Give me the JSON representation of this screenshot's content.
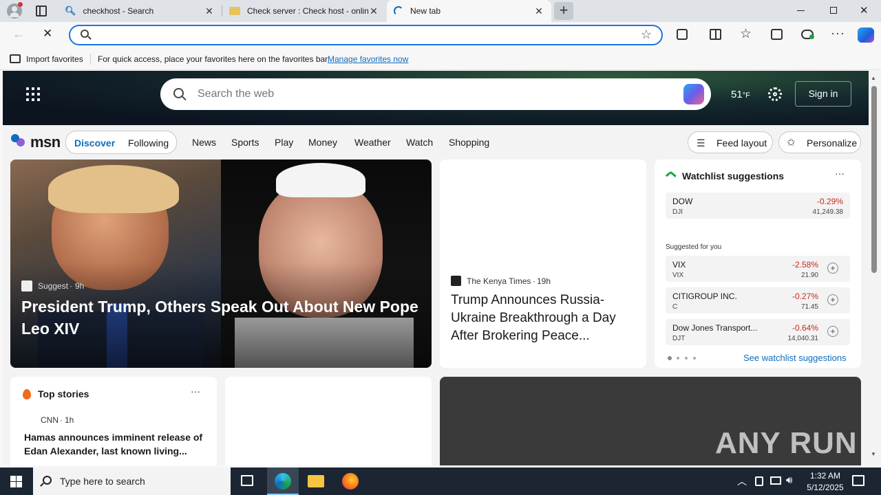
{
  "tabs": [
    {
      "title": "checkhost - Search",
      "icon": "search-icon"
    },
    {
      "title": "Check server : Check host - onlin",
      "icon": "folder-icon"
    },
    {
      "title": "New tab",
      "icon": "loading-icon"
    }
  ],
  "address": {
    "value": "",
    "placeholder": ""
  },
  "favorites_bar": {
    "import_label": "Import favorites",
    "hint": "For quick access, place your favorites here on the favorites bar.",
    "manage_link": "Manage favorites now"
  },
  "msn": {
    "search_placeholder": "Search the web",
    "weather": "51",
    "weather_unit": "°F",
    "sign_in": "Sign in",
    "logo": "msn",
    "tabs": [
      "Discover",
      "Following"
    ],
    "nav": [
      "News",
      "Sports",
      "Play",
      "Money",
      "Weather",
      "Watch",
      "Shopping"
    ],
    "feed_layout": "Feed layout",
    "personalize": "Personalize"
  },
  "hero_story": {
    "source": "Suggest",
    "age": "9h",
    "headline": "President Trump, Others Speak Out About New Pope Leo XIV"
  },
  "side_story": {
    "source": "The Kenya Times",
    "age": "19h",
    "headline": "Trump Announces Russia-Ukraine Breakthrough a Day After Brokering Peace..."
  },
  "watchlist": {
    "title": "Watchlist suggestions",
    "top": {
      "name": "DOW",
      "symbol": "DJI",
      "change": "-0.29%",
      "value": "41,249.38"
    },
    "suggested_label": "Suggested for you",
    "items": [
      {
        "name": "VIX",
        "symbol": "VIX",
        "change": "-2.58%",
        "value": "21.90"
      },
      {
        "name": "CITIGROUP INC.",
        "symbol": "C",
        "change": "-0.27%",
        "value": "71.45"
      },
      {
        "name": "Dow Jones Transport...",
        "symbol": "DJT",
        "change": "-0.64%",
        "value": "14,040.31"
      }
    ],
    "see_link": "See watchlist suggestions"
  },
  "top_stories": {
    "title": "Top stories",
    "source": "CNN",
    "age": "1h",
    "headline": "Hamas announces imminent release of Edan Alexander, last known living..."
  },
  "watermark": "ANY RUN",
  "taskbar": {
    "search_placeholder": "Type here to search",
    "time": "1:32 AM",
    "date": "5/12/2025"
  },
  "colors": {
    "accent": "#0f6cbd",
    "negative": "#c42b1c",
    "taskbar": "#1c2633"
  }
}
